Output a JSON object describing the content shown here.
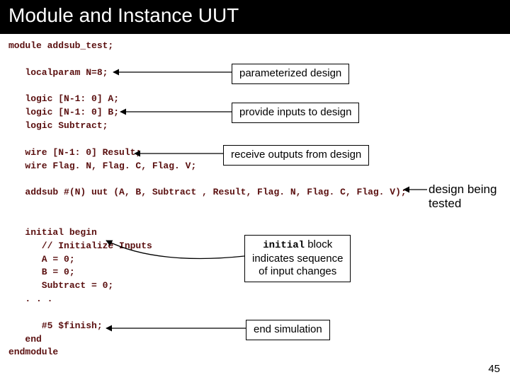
{
  "title": "Module and Instance UUT",
  "code": {
    "line1": "module addsub_test;",
    "blank1": "",
    "line2": "   localparam N=8;",
    "blank2": "",
    "line3": "   logic [N-1: 0] A;",
    "line4": "   logic [N-1: 0] B;",
    "line5": "   logic Subtract;",
    "blank3": "",
    "line6": "   wire [N-1: 0] Result;",
    "line7": "   wire Flag. N, Flag. C, Flag. V;",
    "blank4": "",
    "line8": "   addsub #(N) uut (A, B, Subtract , Result, Flag. N, Flag. C, Flag. V);",
    "blank5": "",
    "blank6": "",
    "line9": "   initial begin",
    "line10": "      // Initialize Inputs",
    "line11": "      A = 0;",
    "line12": "      B = 0;",
    "line13": "      Subtract = 0;",
    "line14": "   . . .",
    "blank7": "",
    "line15": "      #5 $finish;",
    "line16": "   end",
    "line17": "endmodule"
  },
  "callouts": {
    "param": "parameterized design",
    "inputs": "provide inputs to design",
    "outputs": "receive outputs from design",
    "initial_pre": "initial",
    "initial_post": " block\nindicates sequence\nof input changes",
    "endsim": "end simulation"
  },
  "side": "design being\ntested",
  "page": "45"
}
